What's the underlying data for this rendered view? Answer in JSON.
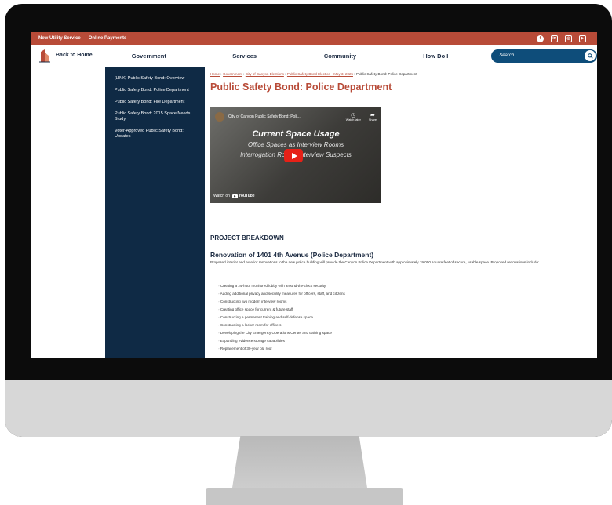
{
  "topbar": {
    "links": [
      "New Utility Service",
      "Online Payments"
    ]
  },
  "social_icons": [
    "facebook-icon",
    "linkedin-icon",
    "instagram-icon",
    "youtube-icon"
  ],
  "nav": {
    "logo_label": "Back to Home",
    "items": [
      "Government",
      "Services",
      "Community",
      "How Do I"
    ],
    "search_placeholder": "Search..."
  },
  "sidebar": {
    "items": [
      "[LINK] Public Safety Bond: Overview",
      "Public Safety Bond: Police Department",
      "Public Safety Bond: Fire Department",
      "Public Safety Bond: 2015 Space Needs Study",
      "Voter-Approved Public Safety Bond: Updates"
    ]
  },
  "breadcrumb": {
    "links": [
      "Home",
      "Government",
      "City of Canyon Elections",
      "Public Safety Bond Election - May 3, 2025"
    ],
    "current": "Public Safety Bond: Police Department",
    "sep": "›"
  },
  "page_title": "Public Safety Bond: Police Department",
  "video": {
    "channel_title": "City of Canyon Public Safety Bond: Poli...",
    "watch_later": "Watch later",
    "share": "Share",
    "overlay_title": "Current Space Usage",
    "overlay_line1": "Office Spaces as Interview Rooms",
    "overlay_line2": "Interrogation Rooms Interview Suspects",
    "watch_on": "Watch on",
    "youtube": "YouTube"
  },
  "section_heading": "PROJECT BREAKDOWN",
  "subheading": "Renovation of 1401 4th Avenue (Police Department)",
  "paragraph": "Proposed interior and exterior renovations to the new police building will provide the Canyon Police Department with approximately 19,000 square feet of secure, usable space. Proposed renovations include:",
  "bullets": [
    "Creating a 24-hour monitored lobby with around-the-clock security",
    "Adding additional privacy and security measures for officers, staff, and citizens",
    "Constructing two modern interview rooms",
    "Creating office space for current & future staff",
    "Constructing a permanent training and self-defense space",
    "Constructing a locker room for officers",
    "Developing the City Emergency Operations Center and training space",
    "Expanding evidence storage capabilities",
    "Replacement of 30-year old roof"
  ],
  "colors": {
    "brand_red": "#b84b38",
    "navy": "#0f2a45",
    "search_blue": "#0e4d7a"
  }
}
